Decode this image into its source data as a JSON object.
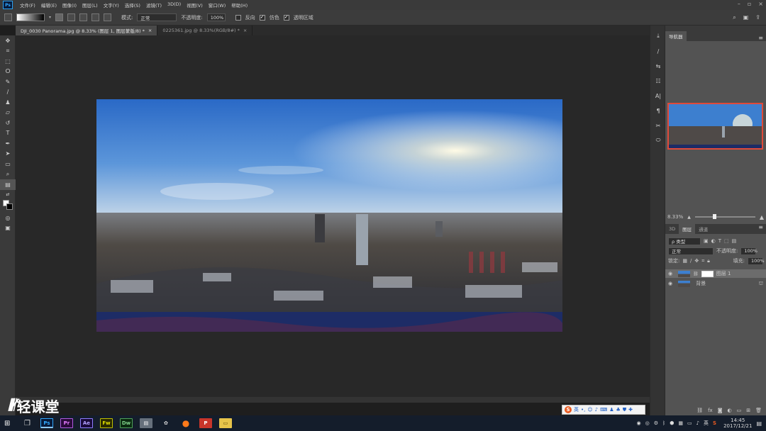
{
  "app": {
    "logo": "Ps"
  },
  "menu": [
    "文件(F)",
    "编辑(E)",
    "图像(I)",
    "图层(L)",
    "文字(Y)",
    "选择(S)",
    "滤镜(T)",
    "3D(D)",
    "视图(V)",
    "窗口(W)",
    "帮助(H)"
  ],
  "options": {
    "mode_label": "模式:",
    "mode_value": "正常",
    "opacity_label": "不透明度:",
    "opacity_value": "100%",
    "reverse": "反向",
    "dither": "仿色",
    "transparency": "透明区域"
  },
  "tabs": [
    {
      "label": "DJI_0030 Panorama.jpg @ 8.33% (图层 1, 图层蒙版/8) *",
      "active": true
    },
    {
      "label": "0225361.jpg @ 8.33%(RGB/8#) *",
      "active": false
    }
  ],
  "navigator": {
    "tab": "导航器",
    "zoom": "8.33%"
  },
  "layers_panel": {
    "tabs": [
      "3D",
      "图层",
      "通道"
    ],
    "kind": "ρ 类型",
    "blend": "正常",
    "opacity_label": "不透明度:",
    "opacity_value": "100%",
    "lock_label": "锁定:",
    "fill_label": "填充:",
    "fill_value": "100%",
    "layers": [
      {
        "name": "图层 1",
        "selected": true
      },
      {
        "name": "背景",
        "selected": false
      }
    ]
  },
  "watermark": {
    "text": "轻课堂"
  },
  "ime": {
    "label": "英"
  },
  "taskbar": {
    "time": "14:45",
    "date": "2017/12/21",
    "ime": "英"
  },
  "colors": {
    "accent": "#31a8ff",
    "nav_border": "#e04a3a",
    "taskbar": "#141d2b"
  }
}
